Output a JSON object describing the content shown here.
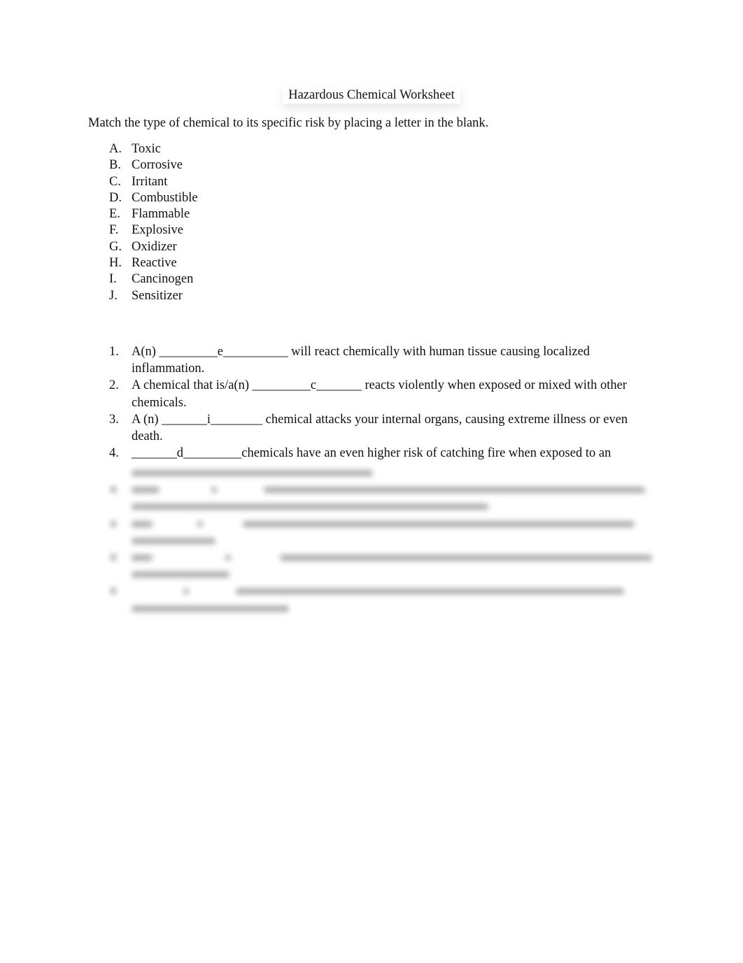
{
  "document": {
    "title": "Hazardous Chemical Worksheet",
    "instructions": "Match the type of chemical to its specific risk by placing a letter in the blank.",
    "choices": [
      {
        "marker": "A.",
        "label": "Toxic"
      },
      {
        "marker": "B.",
        "label": "Corrosive"
      },
      {
        "marker": "C.",
        "label": "Irritant"
      },
      {
        "marker": "D.",
        "label": "Combustible"
      },
      {
        "marker": "E.",
        "label": "Flammable"
      },
      {
        "marker": "F.",
        "label": "Explosive"
      },
      {
        "marker": "G.",
        "label": "Oxidizer"
      },
      {
        "marker": "H.",
        "label": "Reactive"
      },
      {
        "marker": "I.",
        "label": "Cancinogen"
      },
      {
        "marker": "J.",
        "label": "Sensitizer"
      }
    ],
    "questions": [
      {
        "marker": "1.",
        "text": "A(n) _________e__________ will react chemically with human tissue causing localized inflammation."
      },
      {
        "marker": "2.",
        "text": "A chemical that is/a(n) _________c_______ reacts violently when exposed or mixed with other chemicals."
      },
      {
        "marker": "3.",
        "text": "A (n) _______i________ chemical attacks your internal organs, causing extreme illness or even death."
      },
      {
        "marker": "4.",
        "text": "_______d_________chemicals have an even higher risk of catching fire when exposed to an"
      }
    ],
    "obscured_content": {
      "state": "blurred",
      "items_obscured": [
        "5.",
        "6.",
        "7.",
        "8."
      ]
    }
  }
}
